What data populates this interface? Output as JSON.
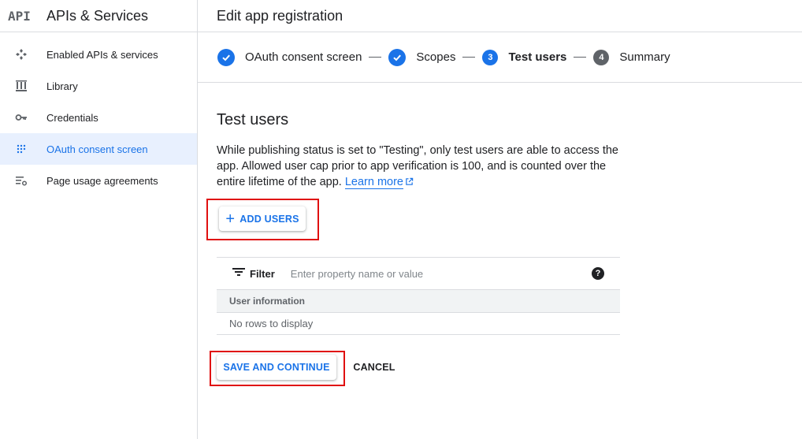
{
  "sidebar": {
    "logo": "API",
    "title": "APIs & Services",
    "items": [
      {
        "label": "Enabled APIs & services",
        "icon": "enabled-apis-icon"
      },
      {
        "label": "Library",
        "icon": "library-icon"
      },
      {
        "label": "Credentials",
        "icon": "key-icon"
      },
      {
        "label": "OAuth consent screen",
        "icon": "oauth-icon",
        "active": true
      },
      {
        "label": "Page usage agreements",
        "icon": "settings-list-icon"
      }
    ]
  },
  "header": {
    "title": "Edit app registration"
  },
  "stepper": {
    "steps": [
      {
        "label": "OAuth consent screen",
        "state": "done"
      },
      {
        "label": "Scopes",
        "state": "done"
      },
      {
        "label": "Test users",
        "number": "3",
        "state": "current"
      },
      {
        "label": "Summary",
        "number": "4",
        "state": "todo"
      }
    ]
  },
  "main": {
    "section_title": "Test users",
    "description": "While publishing status is set to \"Testing\", only test users are able to access the app. Allowed user cap prior to app verification is 100, and is counted over the entire lifetime of the app.",
    "learn_more": "Learn more",
    "add_users_label": "ADD USERS",
    "filter": {
      "label": "Filter",
      "placeholder": "Enter property name or value"
    },
    "table": {
      "column": "User information",
      "empty_text": "No rows to display"
    },
    "save_label": "SAVE AND CONTINUE",
    "cancel_label": "CANCEL"
  },
  "colors": {
    "accent": "#1a73e8",
    "highlight": "#e01010",
    "active_bg": "#e8f0fe"
  }
}
